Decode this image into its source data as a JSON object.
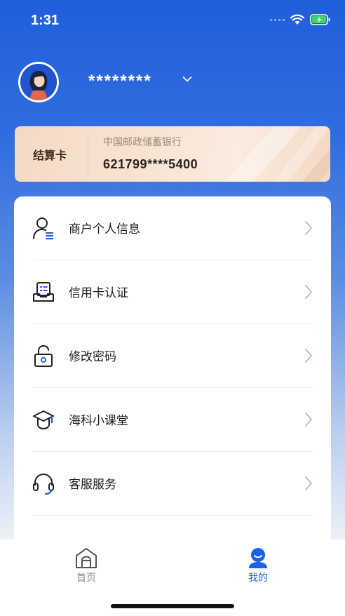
{
  "status_bar": {
    "time": "1:31",
    "icons": [
      "signal-dots-icon",
      "wifi-icon",
      "battery-charging-icon"
    ]
  },
  "profile": {
    "username": "********",
    "avatar_icon": "user-avatar-icon",
    "dropdown_icon": "chevron-down-icon"
  },
  "card": {
    "type_label": "结算卡",
    "bank_name": "中国邮政储蓄银行",
    "card_number": "621799****5400"
  },
  "menu": {
    "items": [
      {
        "label": "商户个人信息",
        "icon": "person-info-icon"
      },
      {
        "label": "信用卡认证",
        "icon": "card-verify-icon"
      },
      {
        "label": "修改密码",
        "icon": "unlock-icon"
      },
      {
        "label": "海科小课堂",
        "icon": "graduation-cap-icon"
      },
      {
        "label": "客服服务",
        "icon": "headset-icon"
      }
    ]
  },
  "tab_bar": {
    "tabs": [
      {
        "label": "首页",
        "icon": "home-icon",
        "active": false
      },
      {
        "label": "我的",
        "icon": "profile-icon",
        "active": true
      }
    ]
  },
  "colors": {
    "accent": "#1b63e0",
    "header_top": "#1f5fdc",
    "card_gold": "#f4dac6",
    "icon_blue": "#2a5bd7"
  }
}
